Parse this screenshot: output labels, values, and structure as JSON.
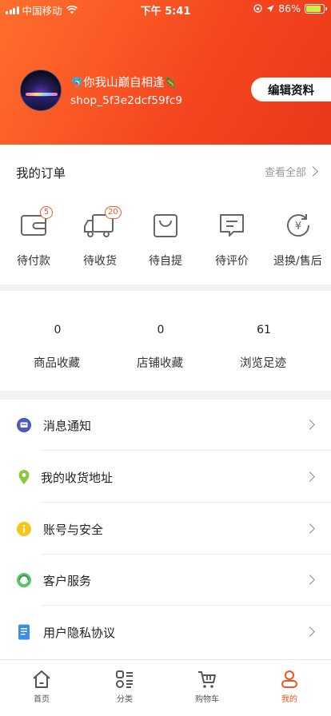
{
  "status_bar": {
    "carrier": "中国移动",
    "time": "下午 5:41",
    "battery": "86%"
  },
  "profile": {
    "nickname": "你我山巅自相逢",
    "nickname_emoji_left": "🐬",
    "nickname_emoji_right": "🦎",
    "username": "shop_5f3e2dcf59fc9",
    "edit_label": "编辑资料"
  },
  "orders": {
    "title": "我的订单",
    "view_all": "查看全部",
    "items": [
      {
        "label": "待付款",
        "badge": "5",
        "icon": "wallet-icon"
      },
      {
        "label": "待收货",
        "badge": "20",
        "icon": "truck-icon"
      },
      {
        "label": "待自提",
        "badge": "",
        "icon": "bag-icon"
      },
      {
        "label": "待评价",
        "badge": "",
        "icon": "comment-icon"
      },
      {
        "label": "退换/售后",
        "badge": "",
        "icon": "refund-icon"
      }
    ]
  },
  "stats": [
    {
      "value": "0",
      "label": "商品收藏"
    },
    {
      "value": "0",
      "label": "店铺收藏"
    },
    {
      "value": "61",
      "label": "浏览足迹"
    }
  ],
  "menu": [
    {
      "label": "消息通知",
      "icon": "message-icon",
      "color": "#4a5bbd"
    },
    {
      "label": "我的收货地址",
      "icon": "location-pin-icon",
      "color": "#8cc63f"
    },
    {
      "label": "账号与安全",
      "icon": "info-icon",
      "color": "#f5c518"
    },
    {
      "label": "客户服务",
      "icon": "customer-service-icon",
      "color": "#5cc36a"
    },
    {
      "label": "用户隐私协议",
      "icon": "document-icon",
      "color": "#3a8ee6"
    }
  ],
  "tabs": [
    {
      "label": "首页",
      "icon": "home-icon"
    },
    {
      "label": "分类",
      "icon": "category-icon"
    },
    {
      "label": "购物车",
      "icon": "cart-icon"
    },
    {
      "label": "我的",
      "icon": "profile-icon",
      "active": true
    }
  ],
  "colors": {
    "accent": "#f0541f",
    "header_start": "#ff6f2c",
    "header_end": "#e9381a"
  }
}
